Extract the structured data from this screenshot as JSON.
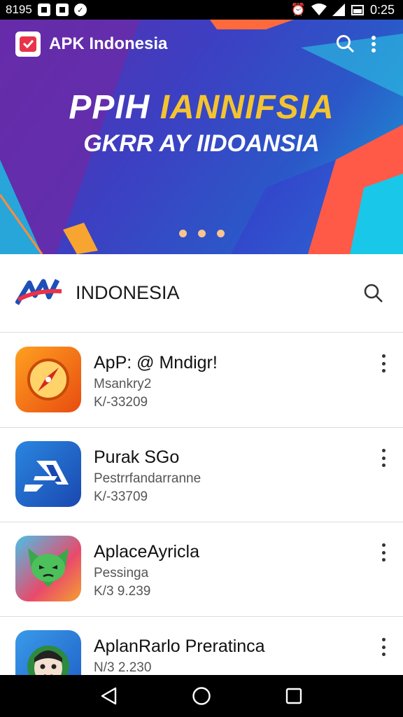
{
  "status_bar": {
    "left_text": "8195",
    "time": "0:25"
  },
  "banner": {
    "app_title": "APK Indonesia",
    "headline_part1": "PPIH ",
    "headline_part2": "IANNIFSIA",
    "subheadline": "GKRR AY IIDOANSIA",
    "carousel_dots": 3
  },
  "section": {
    "title": "INDONESIA"
  },
  "apps": [
    {
      "name": "ApP: @ Mndigr!",
      "subtitle": "Msankry2",
      "meta": "K/-33209",
      "icon": "compass-icon",
      "color": "#f06a1a"
    },
    {
      "name": "Purak SGo",
      "subtitle": "Pestrrfandarranne",
      "meta": "K/-33709",
      "icon": "stripes-icon",
      "color": "#1e5fc8"
    },
    {
      "name": "AplaceAyricla",
      "subtitle": "Pessinga",
      "meta": "K/3 9.239",
      "icon": "green-creature-icon",
      "color": "#e94a6b"
    },
    {
      "name": "AplanRarlo Preratinca",
      "subtitle": "",
      "meta": "N/3 2.230",
      "icon": "mascot-face-icon",
      "color": "#2f7de0"
    }
  ],
  "colors": {
    "accent": "#e8334a",
    "banner_start": "#5a2fb0",
    "banner_end": "#19a0d6"
  }
}
